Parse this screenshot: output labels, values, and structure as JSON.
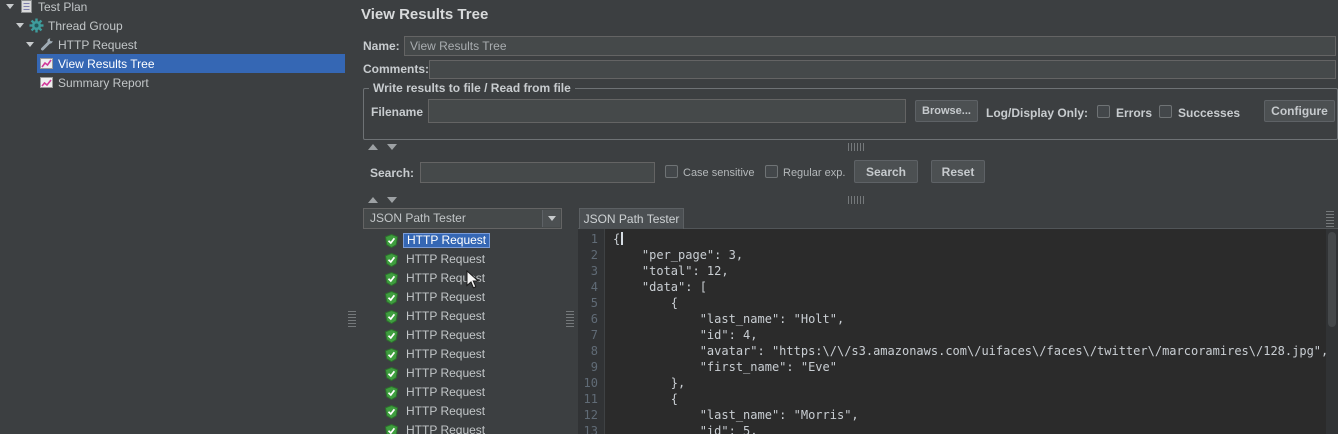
{
  "tree": {
    "items": [
      {
        "label": "Test Plan"
      },
      {
        "label": "Thread Group"
      },
      {
        "label": "HTTP Request"
      },
      {
        "label": "View Results Tree"
      },
      {
        "label": "Summary Report"
      }
    ]
  },
  "main": {
    "title": "View Results Tree",
    "name": {
      "label": "Name:",
      "value": "View Results Tree"
    },
    "comments": {
      "label": "Comments:",
      "value": ""
    },
    "file_group": {
      "legend": "Write results to file / Read from file",
      "filename_label": "Filename",
      "filename_value": "",
      "browse_button": "Browse...",
      "log_display_label": "Log/Display Only:",
      "errors_label": "Errors",
      "successes_label": "Successes",
      "configure_button": "Configure"
    },
    "search_bar": {
      "label": "Search:",
      "value": "",
      "case_sensitive_label": "Case sensitive",
      "regular_exp_label": "Regular exp.",
      "search_button": "Search",
      "reset_button": "Reset"
    }
  },
  "results_panel": {
    "renderer_selector": "JSON Path Tester",
    "selected_index": 0,
    "items": [
      "HTTP Request",
      "HTTP Request",
      "HTTP Request",
      "HTTP Request",
      "HTTP Request",
      "HTTP Request",
      "HTTP Request",
      "HTTP Request",
      "HTTP Request",
      "HTTP Request",
      "HTTP Request"
    ]
  },
  "viewer_panel": {
    "tab_label": "JSON Path Tester",
    "code_lines": [
      {
        "no": "1",
        "text": "{"
      },
      {
        "no": "2",
        "text": "    \"per_page\": 3,"
      },
      {
        "no": "3",
        "text": "    \"total\": 12,"
      },
      {
        "no": "4",
        "text": "    \"data\": ["
      },
      {
        "no": "5",
        "text": "        {"
      },
      {
        "no": "6",
        "text": "            \"last_name\": \"Holt\","
      },
      {
        "no": "7",
        "text": "            \"id\": 4,"
      },
      {
        "no": "8",
        "text": "            \"avatar\": \"https:\\/\\/s3.amazonaws.com\\/uifaces\\/faces\\/twitter\\/marcoramires\\/128.jpg\","
      },
      {
        "no": "9",
        "text": "            \"first_name\": \"Eve\""
      },
      {
        "no": "10",
        "text": "        },"
      },
      {
        "no": "11",
        "text": "        {"
      },
      {
        "no": "12",
        "text": "            \"last_name\": \"Morris\","
      },
      {
        "no": "13",
        "text": "            \"id\": 5,"
      }
    ]
  },
  "colors": {
    "selection_blue": "#3567b4",
    "panel_bg": "#3c3f41",
    "editor_bg": "#2b2b2b",
    "shield_green": "#3f9e3f"
  }
}
